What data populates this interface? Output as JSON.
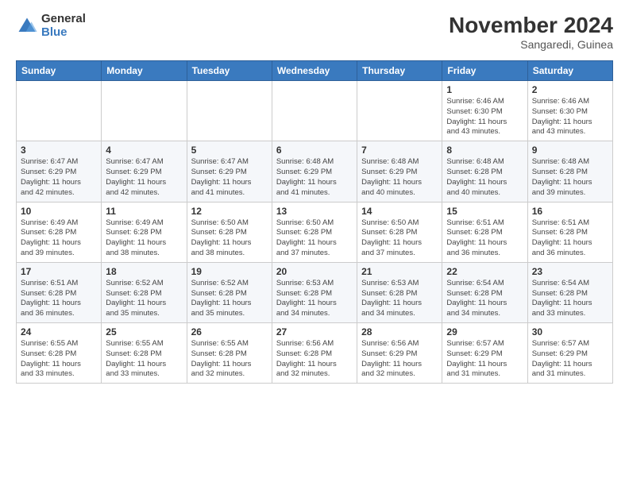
{
  "logo": {
    "general": "General",
    "blue": "Blue"
  },
  "title": "November 2024",
  "location": "Sangaredi, Guinea",
  "days_of_week": [
    "Sunday",
    "Monday",
    "Tuesday",
    "Wednesday",
    "Thursday",
    "Friday",
    "Saturday"
  ],
  "weeks": [
    [
      {
        "day": "",
        "info": ""
      },
      {
        "day": "",
        "info": ""
      },
      {
        "day": "",
        "info": ""
      },
      {
        "day": "",
        "info": ""
      },
      {
        "day": "",
        "info": ""
      },
      {
        "day": "1",
        "info": "Sunrise: 6:46 AM\nSunset: 6:30 PM\nDaylight: 11 hours\nand 43 minutes."
      },
      {
        "day": "2",
        "info": "Sunrise: 6:46 AM\nSunset: 6:30 PM\nDaylight: 11 hours\nand 43 minutes."
      }
    ],
    [
      {
        "day": "3",
        "info": "Sunrise: 6:47 AM\nSunset: 6:29 PM\nDaylight: 11 hours\nand 42 minutes."
      },
      {
        "day": "4",
        "info": "Sunrise: 6:47 AM\nSunset: 6:29 PM\nDaylight: 11 hours\nand 42 minutes."
      },
      {
        "day": "5",
        "info": "Sunrise: 6:47 AM\nSunset: 6:29 PM\nDaylight: 11 hours\nand 41 minutes."
      },
      {
        "day": "6",
        "info": "Sunrise: 6:48 AM\nSunset: 6:29 PM\nDaylight: 11 hours\nand 41 minutes."
      },
      {
        "day": "7",
        "info": "Sunrise: 6:48 AM\nSunset: 6:29 PM\nDaylight: 11 hours\nand 40 minutes."
      },
      {
        "day": "8",
        "info": "Sunrise: 6:48 AM\nSunset: 6:28 PM\nDaylight: 11 hours\nand 40 minutes."
      },
      {
        "day": "9",
        "info": "Sunrise: 6:48 AM\nSunset: 6:28 PM\nDaylight: 11 hours\nand 39 minutes."
      }
    ],
    [
      {
        "day": "10",
        "info": "Sunrise: 6:49 AM\nSunset: 6:28 PM\nDaylight: 11 hours\nand 39 minutes."
      },
      {
        "day": "11",
        "info": "Sunrise: 6:49 AM\nSunset: 6:28 PM\nDaylight: 11 hours\nand 38 minutes."
      },
      {
        "day": "12",
        "info": "Sunrise: 6:50 AM\nSunset: 6:28 PM\nDaylight: 11 hours\nand 38 minutes."
      },
      {
        "day": "13",
        "info": "Sunrise: 6:50 AM\nSunset: 6:28 PM\nDaylight: 11 hours\nand 37 minutes."
      },
      {
        "day": "14",
        "info": "Sunrise: 6:50 AM\nSunset: 6:28 PM\nDaylight: 11 hours\nand 37 minutes."
      },
      {
        "day": "15",
        "info": "Sunrise: 6:51 AM\nSunset: 6:28 PM\nDaylight: 11 hours\nand 36 minutes."
      },
      {
        "day": "16",
        "info": "Sunrise: 6:51 AM\nSunset: 6:28 PM\nDaylight: 11 hours\nand 36 minutes."
      }
    ],
    [
      {
        "day": "17",
        "info": "Sunrise: 6:51 AM\nSunset: 6:28 PM\nDaylight: 11 hours\nand 36 minutes."
      },
      {
        "day": "18",
        "info": "Sunrise: 6:52 AM\nSunset: 6:28 PM\nDaylight: 11 hours\nand 35 minutes."
      },
      {
        "day": "19",
        "info": "Sunrise: 6:52 AM\nSunset: 6:28 PM\nDaylight: 11 hours\nand 35 minutes."
      },
      {
        "day": "20",
        "info": "Sunrise: 6:53 AM\nSunset: 6:28 PM\nDaylight: 11 hours\nand 34 minutes."
      },
      {
        "day": "21",
        "info": "Sunrise: 6:53 AM\nSunset: 6:28 PM\nDaylight: 11 hours\nand 34 minutes."
      },
      {
        "day": "22",
        "info": "Sunrise: 6:54 AM\nSunset: 6:28 PM\nDaylight: 11 hours\nand 34 minutes."
      },
      {
        "day": "23",
        "info": "Sunrise: 6:54 AM\nSunset: 6:28 PM\nDaylight: 11 hours\nand 33 minutes."
      }
    ],
    [
      {
        "day": "24",
        "info": "Sunrise: 6:55 AM\nSunset: 6:28 PM\nDaylight: 11 hours\nand 33 minutes."
      },
      {
        "day": "25",
        "info": "Sunrise: 6:55 AM\nSunset: 6:28 PM\nDaylight: 11 hours\nand 33 minutes."
      },
      {
        "day": "26",
        "info": "Sunrise: 6:55 AM\nSunset: 6:28 PM\nDaylight: 11 hours\nand 32 minutes."
      },
      {
        "day": "27",
        "info": "Sunrise: 6:56 AM\nSunset: 6:28 PM\nDaylight: 11 hours\nand 32 minutes."
      },
      {
        "day": "28",
        "info": "Sunrise: 6:56 AM\nSunset: 6:29 PM\nDaylight: 11 hours\nand 32 minutes."
      },
      {
        "day": "29",
        "info": "Sunrise: 6:57 AM\nSunset: 6:29 PM\nDaylight: 11 hours\nand 31 minutes."
      },
      {
        "day": "30",
        "info": "Sunrise: 6:57 AM\nSunset: 6:29 PM\nDaylight: 11 hours\nand 31 minutes."
      }
    ]
  ]
}
